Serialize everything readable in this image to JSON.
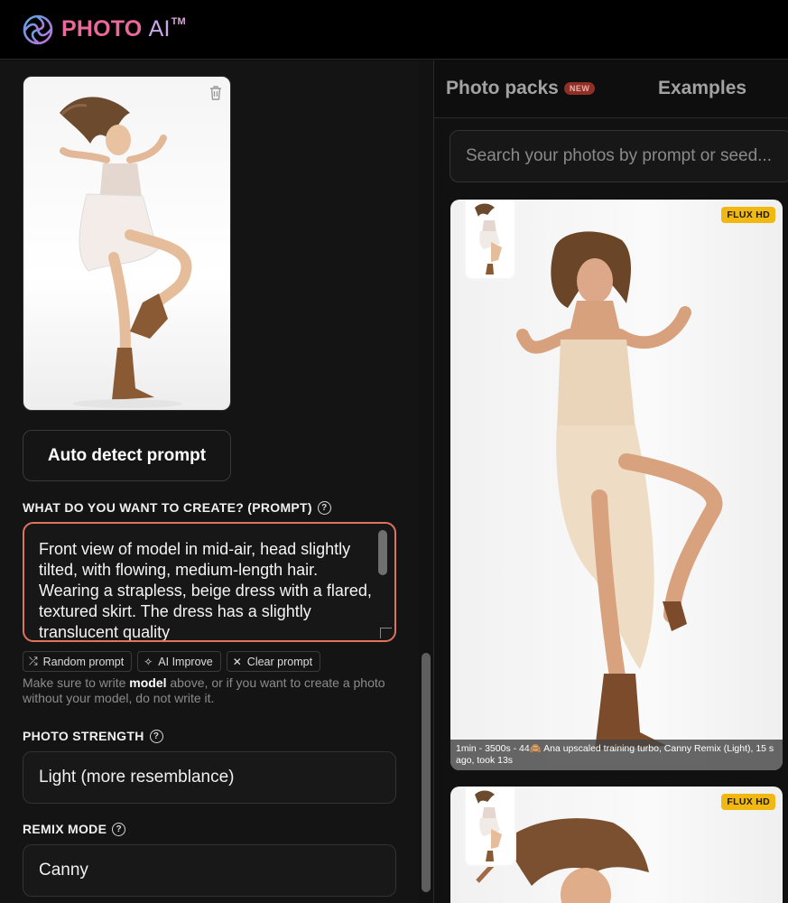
{
  "app": {
    "logo_photo": "PHOTO",
    "logo_ai": "AI",
    "logo_tm": "TM"
  },
  "left": {
    "auto_detect_label": "Auto detect prompt",
    "prompt_section_label": "WHAT DO YOU WANT TO CREATE? (PROMPT)",
    "prompt_value": "Front view of model in mid-air, head slightly tilted, with flowing, medium-length hair. Wearing a strapless, beige dress with a flared, textured skirt. The dress has a slightly translucent quality",
    "chips": {
      "random": "Random prompt",
      "improve": "AI Improve",
      "clear": "Clear prompt"
    },
    "hint_before": "Make sure to write ",
    "hint_bold": "model",
    "hint_after": " above, or if you want to create a photo without your model, do not write it.",
    "strength_label": "PHOTO STRENGTH",
    "strength_value": "Light (more resemblance)",
    "remix_label": "REMIX MODE",
    "remix_value": "Canny",
    "help_glyph": "?"
  },
  "right": {
    "tab_packs": "Photo packs",
    "tab_packs_badge": "NEW",
    "tab_examples": "Examples",
    "search_placeholder": "Search your photos by prompt or seed...",
    "results": [
      {
        "badge": "FLUX HD",
        "caption": "1min - 3500s - 44🙈 Ana upscaled training turbo, Canny Remix (Light), 15 s ago, took 13s"
      },
      {
        "badge": "FLUX HD"
      }
    ]
  },
  "colors": {
    "accent_border": "#e0735a",
    "flux_badge": "#f1b812",
    "logo_pink": "#e8699a"
  },
  "icons": [
    "photoai-logo-icon",
    "trash-icon",
    "shuffle-icon",
    "sparkle-icon",
    "close-icon",
    "help-icon"
  ]
}
